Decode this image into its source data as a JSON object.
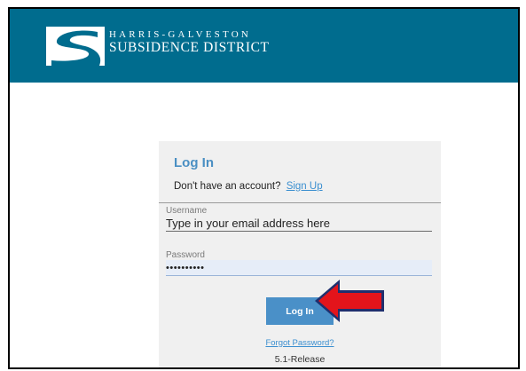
{
  "header": {
    "org_line1": "HARRIS-GALVESTON",
    "org_line2": "SUBSIDENCE DISTRICT",
    "logo_icon": "stylized-s-logo",
    "background": "#006c8e"
  },
  "login": {
    "title": "Log In",
    "signup_prompt": "Don't have an account?",
    "signup_link": "Sign Up",
    "username": {
      "label": "Username",
      "placeholder": "Type in your email address here",
      "value": ""
    },
    "password": {
      "label": "Password",
      "value": "••••••••••"
    },
    "submit_label": "Log In",
    "forgot_link": "Forgot Password?",
    "version": "5.1-Release",
    "accent": "#4a90c8"
  },
  "annotation": {
    "icon": "red-arrow-left-icon",
    "color": "#e3141b"
  }
}
